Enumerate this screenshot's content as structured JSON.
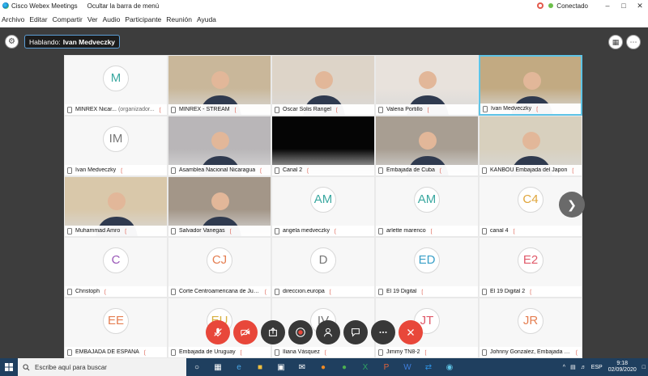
{
  "window": {
    "title": "Cisco Webex Meetings",
    "hide_menu": "Ocultar la barra de menú",
    "status": "Conectado"
  },
  "menu": [
    "Archivo",
    "Editar",
    "Compartir",
    "Ver",
    "Audio",
    "Participante",
    "Reunión",
    "Ayuda"
  ],
  "speaking": {
    "label": "Hablando:",
    "name": "Ivan Medveczky"
  },
  "tiles": [
    {
      "name": "MINREX Nicar...",
      "org": "(organizador...",
      "initials": "M",
      "initials_color": "#3aa8a0"
    },
    {
      "name": "MINREX - STREAM",
      "video": true,
      "bg": "#c9b79a"
    },
    {
      "name": "Oscar Solis Rangel",
      "video": true,
      "bg": "#ddd4c8"
    },
    {
      "name": "Valeria Portillo",
      "video": true,
      "bg": "#e8e2dc"
    },
    {
      "name": "Ivan Medveczky",
      "video": true,
      "bg": "#c2aa82",
      "active": true
    },
    {
      "name": "Ivan Medveczky",
      "initials": "IM",
      "initials_color": "#777777"
    },
    {
      "name": "Asamblea Nacional Nicaragua",
      "video": true,
      "bg": "#b9b6b8"
    },
    {
      "name": "Canal 2",
      "video": true,
      "bg": "#050505"
    },
    {
      "name": "Embajada de Cuba",
      "video": true,
      "bg": "#a89e92"
    },
    {
      "name": "KANBOU Embajada del Japon",
      "video": true,
      "bg": "#d8d0be"
    },
    {
      "name": "Muhammad Amro",
      "video": true,
      "bg": "#d9c8aa"
    },
    {
      "name": "Salvador Vanegas",
      "video": true,
      "bg": "#a39688"
    },
    {
      "name": "angela medveczky",
      "initials": "AM",
      "initials_color": "#3aa8a0"
    },
    {
      "name": "arlette marenco",
      "initials": "AM",
      "initials_color": "#3aa8a0"
    },
    {
      "name": "canal 4",
      "initials": "C4",
      "initials_color": "#e0a53a"
    },
    {
      "name": "Christoph",
      "initials": "C",
      "initials_color": "#9a57b8"
    },
    {
      "name": "Corte Centroamericana de Jus...",
      "initials": "CJ",
      "initials_color": "#e57f52"
    },
    {
      "name": "direccion.europa",
      "initials": "D",
      "initials_color": "#777777"
    },
    {
      "name": "El 19 Digital",
      "initials": "ED",
      "initials_color": "#3aa0c8"
    },
    {
      "name": "El 19 Digital 2",
      "initials": "E2",
      "initials_color": "#e05a6a"
    },
    {
      "name": "EMBAJADA DE ESPAÑA",
      "initials": "EE",
      "initials_color": "#e57f52"
    },
    {
      "name": "Embajada de Uruguay",
      "initials": "EU",
      "initials_color": "#d8b040"
    },
    {
      "name": "Iliana Vásquez",
      "initials": "IV",
      "initials_color": "#777777"
    },
    {
      "name": "Jimmy TN8-2",
      "initials": "JT",
      "initials_color": "#e05a6a"
    },
    {
      "name": "Johnny Gonzalez, Embajada RD",
      "initials": "JR",
      "initials_color": "#e57f52"
    }
  ],
  "taskbar": {
    "search_placeholder": "Escribe aquí para buscar",
    "language": "ESP",
    "time": "9:18",
    "date": "02/09/2020"
  },
  "colors": {
    "accent": "#5fc4e6",
    "danger": "#e8473a",
    "meeting_bg": "#3d3d3d",
    "taskbar_bg": "#1f3f5f"
  }
}
